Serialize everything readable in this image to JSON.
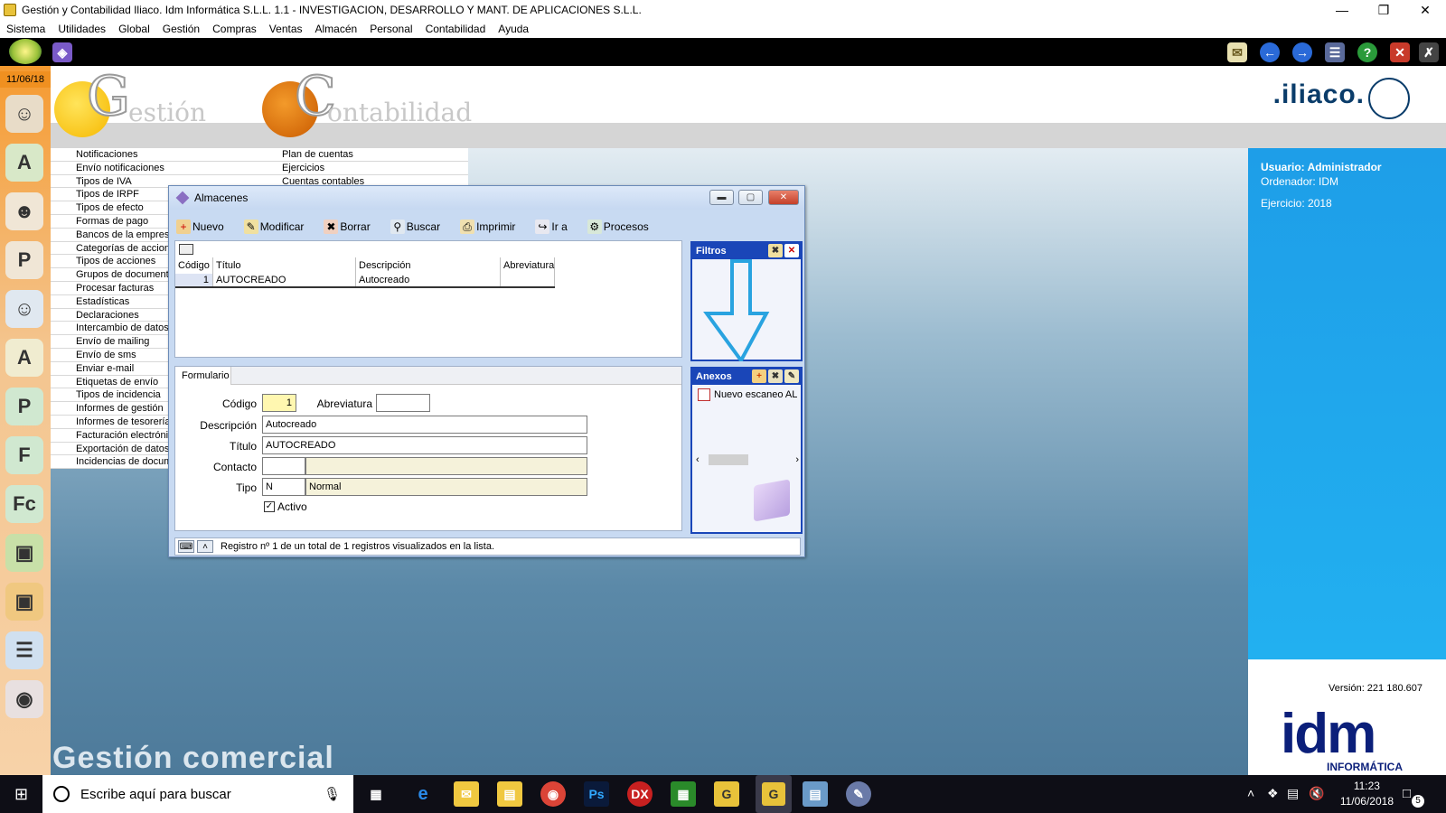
{
  "window_title": "Gestión y Contabilidad Iliaco. Idm Informática S.L.L. 1.1 - INVESTIGACION, DESARROLLO Y MANT. DE APLICACIONES S.L.L.",
  "menu": [
    "Sistema",
    "Utilidades",
    "Global",
    "Gestión",
    "Compras",
    "Ventas",
    "Almacén",
    "Personal",
    "Contabilidad",
    "Ayuda"
  ],
  "date": "11/06/18",
  "logos": {
    "g_letter": "G",
    "g_text": "estión",
    "c_letter": "C",
    "c_text": "ontabilidad",
    "iliaco": ".iliaco."
  },
  "left_menu": [
    "Notificaciones",
    "Envío notificaciones",
    "Tipos de IVA",
    "Tipos de IRPF",
    "Tipos de efecto",
    "Formas de pago",
    "Bancos de la empresa",
    "Categorías de acciones",
    "Tipos de acciones",
    "Grupos de documentos",
    "Procesar facturas",
    "Estadísticas",
    "Declaraciones",
    "Intercambio de datos",
    "Envío de mailing",
    "Envío de sms",
    "Enviar e-mail",
    "Etiquetas de envío",
    "Tipos de incidencia",
    "Informes de gestión",
    "Informes de tesorería",
    "Facturación electrónica",
    "Exportación de datos",
    "Incidencias de documentos"
  ],
  "right_menu": [
    "Plan de cuentas",
    "Ejercicios",
    "Cuentas contables"
  ],
  "footer_label": "Gestión comercial",
  "user_panel": {
    "usuario": "Usuario: Administrador",
    "ordenador": "Ordenador: IDM",
    "ejercicio": "Ejercicio: 2018",
    "version": "Versión: 221 180.607",
    "brand": "idm",
    "brand_sub": "INFORMÁTICA"
  },
  "dialog": {
    "title": "Almacenes",
    "toolbar": [
      "Nuevo",
      "Modificar",
      "Borrar",
      "Buscar",
      "Imprimir",
      "Ir a",
      "Procesos"
    ],
    "grid_columns": [
      "Código",
      "Título",
      "Descripción",
      "Abreviatura"
    ],
    "grid_rows": [
      [
        "1",
        "AUTOCREADO",
        "Autocreado",
        ""
      ]
    ],
    "filtros_label": "Filtros",
    "anexos_label": "Anexos",
    "anexo_item": "Nuevo escaneo AL",
    "form_tab": "Formulario",
    "labels": {
      "codigo": "Código",
      "abreviatura": "Abreviatura",
      "descripcion": "Descripción",
      "titulo": "Título",
      "contacto": "Contacto",
      "tipo": "Tipo",
      "activo": "Activo"
    },
    "values": {
      "codigo": "1",
      "abreviatura": "",
      "descripcion": "Autocreado",
      "titulo": "AUTOCREADO",
      "contacto": "",
      "contacto_desc": "",
      "tipo": "N",
      "tipo_desc": "Normal",
      "activo": true
    },
    "status": "Registro nº 1 de un total de 1 registros visualizados en la lista."
  },
  "taskbar": {
    "search_placeholder": "Escribe aquí para buscar",
    "time": "11:23",
    "date": "11/06/2018",
    "notifications": "5"
  },
  "colors": {
    "accent_blue": "#1a46b8",
    "info_panel": "#1e9ee8",
    "annotation_arrow": "#29a3e0"
  }
}
